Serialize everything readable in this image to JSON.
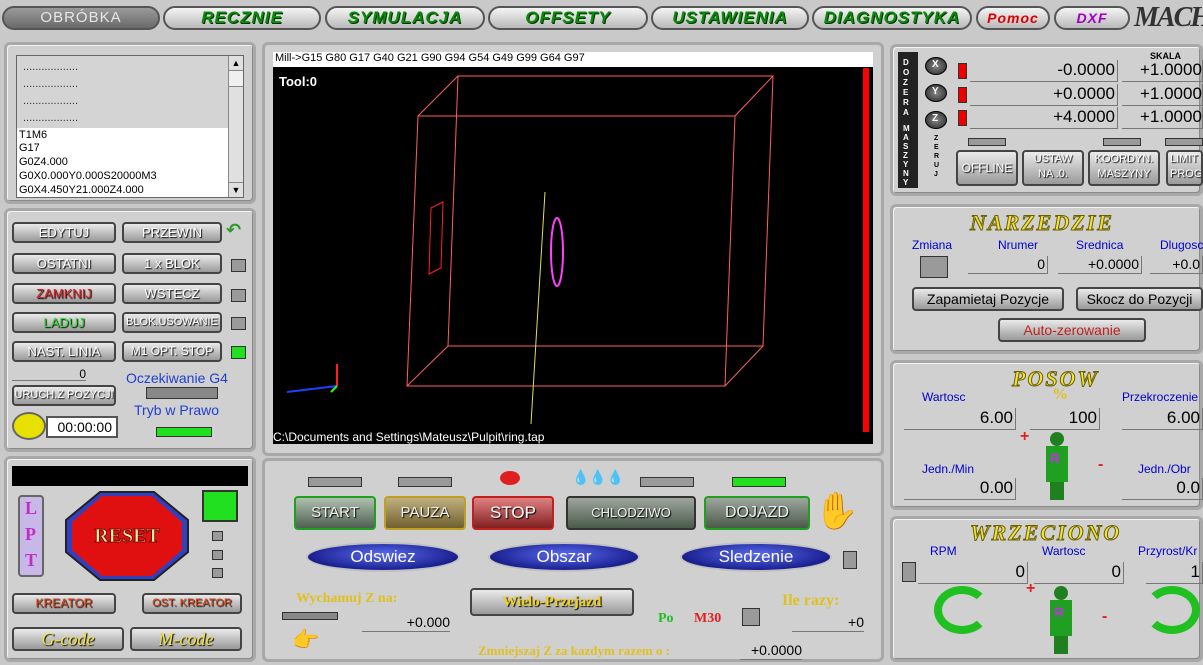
{
  "tabs": {
    "obrobka": "OBRÓBKA",
    "recznie": "RECZNIE",
    "symulacja": "SYMULACJA",
    "offsety": "OFFSETY",
    "ustawienia": "USTAWIENIA",
    "diagnostyka": "DIAGNOSTYKA",
    "pomoc": "Pomoc",
    "dxf": "DXF",
    "logo": "MACH"
  },
  "gcode_list": {
    "dots": [
      "..................",
      "..................",
      "..................",
      ".................."
    ],
    "lines": [
      "T1M6",
      "G17",
      "G0Z4.000",
      "G0X0.000Y0.000S20000M3",
      "G0X4.450Y21.000Z4.000"
    ]
  },
  "prog_buttons": {
    "edytuj": "EDYTUJ",
    "przewin": "PRZEWIN",
    "ostatni": "OSTATNI",
    "one_blok": "1 x BLOK",
    "zamknij": "ZAMKNIJ",
    "wstecz": "WSTECZ",
    "laduj": "LADUJ",
    "blok_usowanie": "BLOK.USOWANIE",
    "nast_linia": "NAST. LINIA",
    "m1_opt_stop": "M1 OPT. STOP",
    "line_no": "0",
    "uruch_z_pozycji": "URUCH.Z POZYCJI",
    "oczekiwanie": "Oczekiwanie G4",
    "tryb": "Tryb w Prawo",
    "timer": "00:00:00"
  },
  "reset_panel": {
    "lpt": [
      "L",
      "P",
      "T"
    ],
    "reset": "RESET",
    "kreator": "KREATOR",
    "ost_kreator": "OST. KREATOR",
    "gcode": "G-code",
    "mcode": "M-code"
  },
  "viewport": {
    "modal": "Mill->G15  G80 G17 G40 G21 G90 G94 G54 G49 G99 G64 G97",
    "tool": "Tool:0",
    "path": "C:\\Documents and Settings\\Mateusz\\Pulpit\\ring.tap"
  },
  "controls": {
    "start": "START",
    "pauza": "PAUZA",
    "stop": "STOP",
    "chlodziwo": "CHLODZIWO",
    "dojazd": "DOJAZD",
    "odswiez": "Odswiez",
    "obszar": "Obszar",
    "sledzenie": "Sledzenie",
    "wychamuj": "Wychamuj Z na:",
    "wychamuj_val": "+0.000",
    "wielo": "Wielo-Przejazd",
    "po": "Po",
    "m30": "M30",
    "ile_razy": "Ile razy:",
    "ile_val": "+0",
    "zmniejszaj": "Zmniejszaj  Z za kazdym razem o :",
    "zmniejszaj_val": "+0.0000"
  },
  "dro": {
    "side_left": "DO ZERA",
    "side_right": "MASZYNY",
    "zeruj": "ZERUJ",
    "skala": "SKALA",
    "axes": [
      {
        "name": "X",
        "value": "-0.0000",
        "scale": "+1.0000"
      },
      {
        "name": "Y",
        "value": "+0.0000",
        "scale": "+1.0000"
      },
      {
        "name": "Z",
        "value": "+4.0000",
        "scale": "+1.0000"
      }
    ],
    "offline": "OFFLINE",
    "ustaw_na_0": [
      "USTAW",
      "NA  .0."
    ],
    "koordyn": [
      "KOORDYN.",
      "MASZYNY"
    ],
    "limit": [
      "LIMIT",
      "PROG"
    ]
  },
  "narzedzie": {
    "title": "NARZEDZIE",
    "zmiana": "Zmiana",
    "numer": "Nrumer",
    "srednica": "Srednica",
    "dlugosc": "Dlugosc",
    "numer_val": "0",
    "srednica_val": "+0.0000",
    "dlugosc_val": "+0.0",
    "zapamietaj": "Zapamietaj Pozycje",
    "skocz": "Skocz do Pozycji",
    "auto": "Auto-zerowanie"
  },
  "posuw": {
    "title": "POSOW",
    "wartosc": "Wartosc",
    "pct": "%",
    "przekroczenie": "Przekroczenie",
    "wartosc_val": "6.00",
    "pct_val": "100",
    "przek_val": "6.00",
    "jedn_min": "Jedn./Min",
    "jedn_min_val": "0.00",
    "jedn_obr": "Jedn./Obr",
    "jedn_obr_val": "0.0",
    "plus": "+",
    "minus": "-",
    "r": "R"
  },
  "wrzeciono": {
    "title": "WRZECIONO",
    "rpm": "RPM",
    "wartosc": "Wartosc",
    "przyrost": "Przyrost/Kr",
    "rpm_val": "0",
    "wartosc_val": "0",
    "przyrost_val": "1",
    "plus": "+",
    "minus": "-",
    "r": "R"
  }
}
